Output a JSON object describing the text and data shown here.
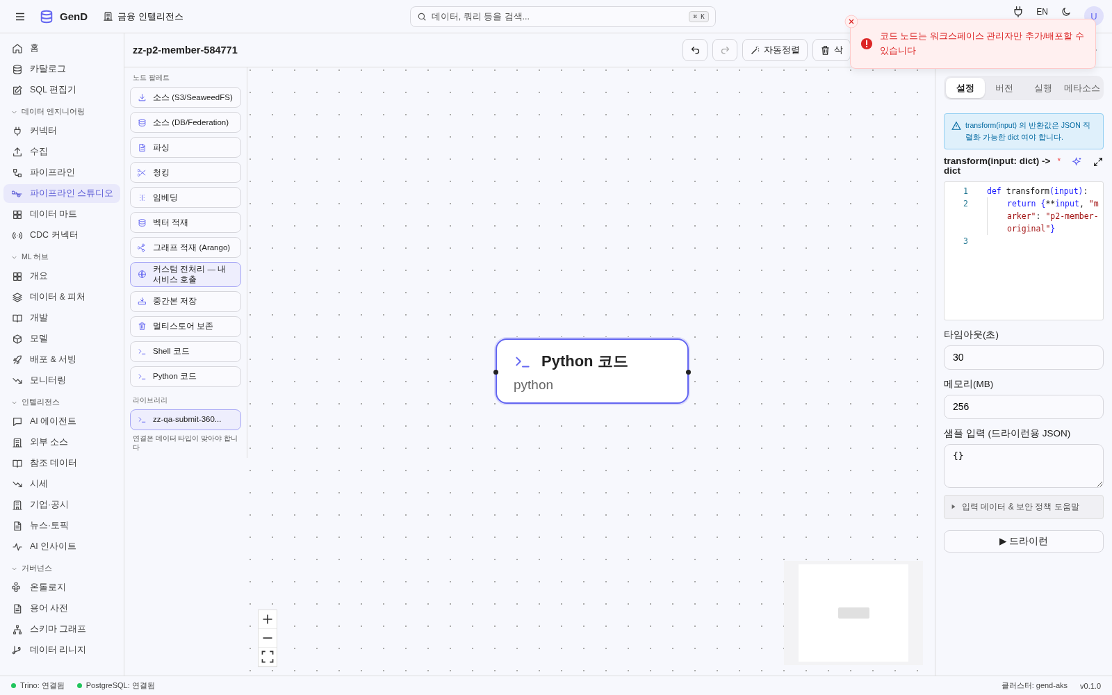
{
  "header": {
    "brand": "GenD",
    "workspace": "금융 인텔리전스",
    "search": {
      "placeholder": "데이터, 쿼리 등을 검색...",
      "shortcut": "⌘ K"
    },
    "language": "EN",
    "avatar": "U"
  },
  "sidebar": {
    "items": [
      {
        "label": "홈",
        "selected": false
      },
      {
        "label": "카탈로그",
        "selected": false
      },
      {
        "label": "SQL 편집기",
        "selected": false
      }
    ],
    "groups": [
      {
        "title": "데이터 엔지니어링",
        "expanded": true,
        "items": [
          {
            "label": "커넥터",
            "selected": false
          },
          {
            "label": "수집",
            "selected": false
          },
          {
            "label": "파이프라인",
            "selected": false
          },
          {
            "label": "파이프라인 스튜디오",
            "selected": true
          },
          {
            "label": "데이터 마트",
            "selected": false
          },
          {
            "label": "CDC 커넥터",
            "selected": false
          }
        ]
      },
      {
        "title": "ML 허브",
        "expanded": true,
        "items": [
          {
            "label": "개요",
            "selected": false
          },
          {
            "label": "데이터 & 피처",
            "selected": false
          },
          {
            "label": "개발",
            "selected": false
          },
          {
            "label": "모델",
            "selected": false
          },
          {
            "label": "배포 & 서빙",
            "selected": false
          },
          {
            "label": "모니터링",
            "selected": false
          }
        ]
      },
      {
        "title": "인텔리전스",
        "expanded": true,
        "items": [
          {
            "label": "AI 에이전트",
            "selected": false
          },
          {
            "label": "외부 소스",
            "selected": false
          },
          {
            "label": "참조 데이터",
            "selected": false
          },
          {
            "label": "시세",
            "selected": false
          },
          {
            "label": "기업·공시",
            "selected": false
          },
          {
            "label": "뉴스·토픽",
            "selected": false
          },
          {
            "label": "AI 인사이트",
            "selected": false
          }
        ]
      },
      {
        "title": "거버넌스",
        "expanded": true,
        "items": [
          {
            "label": "온톨로지",
            "selected": false
          },
          {
            "label": "용어 사전",
            "selected": false
          },
          {
            "label": "스키마 그래프",
            "selected": false
          },
          {
            "label": "데이터 리니지",
            "selected": false
          }
        ]
      }
    ]
  },
  "pipeline": {
    "title": "zz-p2-member-584771",
    "toolbar": {
      "undo_disabled": false,
      "redo_disabled": true,
      "auto_layout": "자동정렬",
      "delete": "삭"
    }
  },
  "palette": {
    "title": "노드 팔레트",
    "items": [
      {
        "label": "소스 (S3/SeaweedFS)",
        "selected": false
      },
      {
        "label": "소스 (DB/Federation)",
        "selected": false
      },
      {
        "label": "파싱",
        "selected": false
      },
      {
        "label": "청킹",
        "selected": false
      },
      {
        "label": "임베딩",
        "selected": false
      },
      {
        "label": "벡터 적재",
        "selected": false
      },
      {
        "label": "그래프 적재 (Arango)",
        "selected": false
      },
      {
        "label": "커스텀 전처리 — 내 서비스 호출",
        "selected": true
      },
      {
        "label": "중간본 저장",
        "selected": false
      },
      {
        "label": "멀티스토어 보존",
        "selected": false
      },
      {
        "label": "Shell 코드",
        "selected": false
      },
      {
        "label": "Python 코드",
        "selected": false
      }
    ],
    "library_title": "라이브러리",
    "library": [
      {
        "label": "zz-qa-submit-360...",
        "selected": true
      }
    ],
    "hint": "연결은 데이터 타입이 맞아야 합니다"
  },
  "canvas": {
    "nodes": [
      {
        "title": "Python 코드",
        "subtitle": "python",
        "selected": true
      }
    ]
  },
  "toast": {
    "message": "코드 노드는 워크스페이스 관리자만 추가/배포할 수 있습니다"
  },
  "panel": {
    "tabs": [
      {
        "label": "설정",
        "selected": true
      },
      {
        "label": "버전",
        "selected": false
      },
      {
        "label": "실행",
        "selected": false
      },
      {
        "label": "메타소스",
        "selected": false
      }
    ],
    "notice": "transform(input) 의 반환값은 JSON 직렬화 가능한 dict 여야 합니다.",
    "code_label": "transform(input: dict) -> dict",
    "required": "*",
    "code": [
      {
        "number": "1",
        "tokens": [
          {
            "kind": "keyword",
            "text": "def"
          },
          {
            "kind": "plain",
            "text": " transform"
          },
          {
            "kind": "keyword",
            "text": "(input)"
          },
          {
            "kind": "plain",
            "text": ":"
          }
        ]
      },
      {
        "number": "2",
        "tokens": [
          {
            "kind": "keyword",
            "text": "return {"
          },
          {
            "kind": "plain",
            "text": "**"
          },
          {
            "kind": "keyword",
            "text": "input"
          },
          {
            "kind": "plain",
            "text": ", "
          },
          {
            "kind": "string",
            "text": "\"marker\""
          },
          {
            "kind": "plain",
            "text": ": "
          },
          {
            "kind": "string",
            "text": "\"p2-member-original\""
          },
          {
            "kind": "keyword",
            "text": "}"
          }
        ]
      },
      {
        "number": "3"
      }
    ],
    "timeout_label": "타임아웃(초)",
    "timeout": "30",
    "memory_label": "메모리(MB)",
    "memory": "256",
    "sample_label": "샘플 입력 (드라이런용 JSON)",
    "sample": "{}",
    "help": {
      "label": "입력 데이터 & 보안 정책 도움말",
      "expanded": false
    },
    "dry_run": "▶ 드라이런"
  },
  "status_bar": {
    "connections": [
      {
        "label": "Trino: 연결됨",
        "color": "#22c55e"
      },
      {
        "label": "PostgreSQL: 연결됨",
        "color": "#22c55e"
      }
    ],
    "cluster": "클러스터: gend-aks",
    "version": "v0.1.0"
  }
}
